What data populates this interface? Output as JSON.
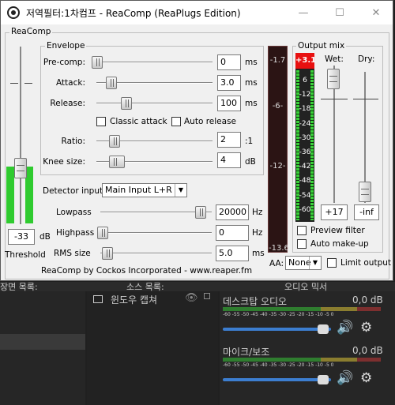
{
  "window": {
    "title": "저역필터:1차컴프 - ReaComp (ReaPlugs Edition)",
    "group_label": "ReaComp"
  },
  "threshold": {
    "label": "Threshold",
    "value": "-33",
    "unit": "dB"
  },
  "envelope": {
    "group_label": "Envelope",
    "precomp": {
      "label": "Pre-comp:",
      "value": "0",
      "unit": "ms"
    },
    "attack": {
      "label": "Attack:",
      "value": "3.0",
      "unit": "ms"
    },
    "release": {
      "label": "Release:",
      "value": "100",
      "unit": "ms"
    },
    "classic_attack": "Classic attack",
    "auto_release": "Auto release",
    "ratio": {
      "label": "Ratio:",
      "value": "2",
      "unit": ":1"
    },
    "knee": {
      "label": "Knee size:",
      "value": "4",
      "unit": "dB"
    }
  },
  "detector": {
    "label": "Detector input:",
    "value": "Main Input L+R",
    "lowpass": {
      "label": "Lowpass",
      "value": "20000",
      "unit": "Hz"
    },
    "highpass": {
      "label": "Highpass",
      "value": "0",
      "unit": "Hz"
    },
    "rms": {
      "label": "RMS size",
      "value": "5.0",
      "unit": "ms"
    }
  },
  "footer": "ReaComp by Cockos Incorporated - www.reaper.fm",
  "input_meter": {
    "top": "-1.7",
    "mid1": "-6-",
    "mid2": "-12-",
    "bottom": "-13.6"
  },
  "output": {
    "group_label": "Output mix",
    "peak": "+3.1",
    "wet": "Wet:",
    "dry": "Dry:",
    "scale": [
      "6",
      "-12",
      "-18",
      "-24",
      "-30",
      "-36",
      "-42",
      "-48",
      "-54",
      "-60"
    ],
    "wet_value": "+17",
    "dry_value": "-inf",
    "preview_filter": "Preview filter",
    "auto_makeup": "Auto make-up"
  },
  "aa": {
    "label": "AA:",
    "value": "None"
  },
  "limit_output": "Limit output",
  "dock": {
    "scenes_header": "장면 목록:",
    "sources_header": "소스 목록:",
    "mixer_header": "오디오 믹서",
    "source_item": "윈도우 캡쳐",
    "channels": [
      {
        "name": "데스크탑 오디오",
        "db": "0,0 dB"
      },
      {
        "name": "마이크/보조",
        "db": "0,0 dB"
      }
    ],
    "scale_text": "-60 -55 -50 -45 -40 -35 -30 -25 -20 -15 -10 -5 0"
  },
  "colors": {
    "meter_green": "#3ad33a",
    "peak_red": "#e81010",
    "accent_blue": "#3c7ed0"
  }
}
